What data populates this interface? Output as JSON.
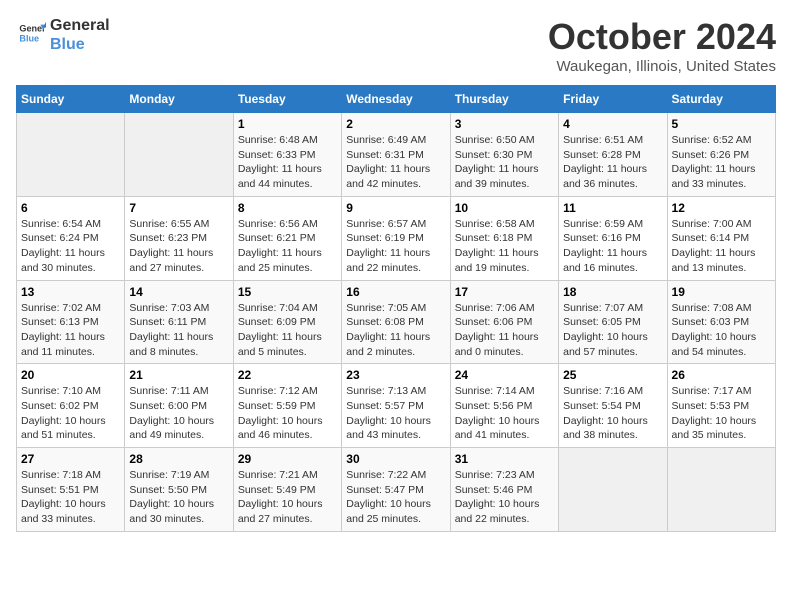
{
  "header": {
    "logo_line1": "General",
    "logo_line2": "Blue",
    "month": "October 2024",
    "location": "Waukegan, Illinois, United States"
  },
  "days_of_week": [
    "Sunday",
    "Monday",
    "Tuesday",
    "Wednesday",
    "Thursday",
    "Friday",
    "Saturday"
  ],
  "weeks": [
    [
      {
        "day": "",
        "empty": true
      },
      {
        "day": "",
        "empty": true
      },
      {
        "day": "1",
        "sunrise": "6:48 AM",
        "sunset": "6:33 PM",
        "daylight": "11 hours and 44 minutes."
      },
      {
        "day": "2",
        "sunrise": "6:49 AM",
        "sunset": "6:31 PM",
        "daylight": "11 hours and 42 minutes."
      },
      {
        "day": "3",
        "sunrise": "6:50 AM",
        "sunset": "6:30 PM",
        "daylight": "11 hours and 39 minutes."
      },
      {
        "day": "4",
        "sunrise": "6:51 AM",
        "sunset": "6:28 PM",
        "daylight": "11 hours and 36 minutes."
      },
      {
        "day": "5",
        "sunrise": "6:52 AM",
        "sunset": "6:26 PM",
        "daylight": "11 hours and 33 minutes."
      }
    ],
    [
      {
        "day": "6",
        "sunrise": "6:54 AM",
        "sunset": "6:24 PM",
        "daylight": "11 hours and 30 minutes."
      },
      {
        "day": "7",
        "sunrise": "6:55 AM",
        "sunset": "6:23 PM",
        "daylight": "11 hours and 27 minutes."
      },
      {
        "day": "8",
        "sunrise": "6:56 AM",
        "sunset": "6:21 PM",
        "daylight": "11 hours and 25 minutes."
      },
      {
        "day": "9",
        "sunrise": "6:57 AM",
        "sunset": "6:19 PM",
        "daylight": "11 hours and 22 minutes."
      },
      {
        "day": "10",
        "sunrise": "6:58 AM",
        "sunset": "6:18 PM",
        "daylight": "11 hours and 19 minutes."
      },
      {
        "day": "11",
        "sunrise": "6:59 AM",
        "sunset": "6:16 PM",
        "daylight": "11 hours and 16 minutes."
      },
      {
        "day": "12",
        "sunrise": "7:00 AM",
        "sunset": "6:14 PM",
        "daylight": "11 hours and 13 minutes."
      }
    ],
    [
      {
        "day": "13",
        "sunrise": "7:02 AM",
        "sunset": "6:13 PM",
        "daylight": "11 hours and 11 minutes."
      },
      {
        "day": "14",
        "sunrise": "7:03 AM",
        "sunset": "6:11 PM",
        "daylight": "11 hours and 8 minutes."
      },
      {
        "day": "15",
        "sunrise": "7:04 AM",
        "sunset": "6:09 PM",
        "daylight": "11 hours and 5 minutes."
      },
      {
        "day": "16",
        "sunrise": "7:05 AM",
        "sunset": "6:08 PM",
        "daylight": "11 hours and 2 minutes."
      },
      {
        "day": "17",
        "sunrise": "7:06 AM",
        "sunset": "6:06 PM",
        "daylight": "11 hours and 0 minutes."
      },
      {
        "day": "18",
        "sunrise": "7:07 AM",
        "sunset": "6:05 PM",
        "daylight": "10 hours and 57 minutes."
      },
      {
        "day": "19",
        "sunrise": "7:08 AM",
        "sunset": "6:03 PM",
        "daylight": "10 hours and 54 minutes."
      }
    ],
    [
      {
        "day": "20",
        "sunrise": "7:10 AM",
        "sunset": "6:02 PM",
        "daylight": "10 hours and 51 minutes."
      },
      {
        "day": "21",
        "sunrise": "7:11 AM",
        "sunset": "6:00 PM",
        "daylight": "10 hours and 49 minutes."
      },
      {
        "day": "22",
        "sunrise": "7:12 AM",
        "sunset": "5:59 PM",
        "daylight": "10 hours and 46 minutes."
      },
      {
        "day": "23",
        "sunrise": "7:13 AM",
        "sunset": "5:57 PM",
        "daylight": "10 hours and 43 minutes."
      },
      {
        "day": "24",
        "sunrise": "7:14 AM",
        "sunset": "5:56 PM",
        "daylight": "10 hours and 41 minutes."
      },
      {
        "day": "25",
        "sunrise": "7:16 AM",
        "sunset": "5:54 PM",
        "daylight": "10 hours and 38 minutes."
      },
      {
        "day": "26",
        "sunrise": "7:17 AM",
        "sunset": "5:53 PM",
        "daylight": "10 hours and 35 minutes."
      }
    ],
    [
      {
        "day": "27",
        "sunrise": "7:18 AM",
        "sunset": "5:51 PM",
        "daylight": "10 hours and 33 minutes."
      },
      {
        "day": "28",
        "sunrise": "7:19 AM",
        "sunset": "5:50 PM",
        "daylight": "10 hours and 30 minutes."
      },
      {
        "day": "29",
        "sunrise": "7:21 AM",
        "sunset": "5:49 PM",
        "daylight": "10 hours and 27 minutes."
      },
      {
        "day": "30",
        "sunrise": "7:22 AM",
        "sunset": "5:47 PM",
        "daylight": "10 hours and 25 minutes."
      },
      {
        "day": "31",
        "sunrise": "7:23 AM",
        "sunset": "5:46 PM",
        "daylight": "10 hours and 22 minutes."
      },
      {
        "day": "",
        "empty": true
      },
      {
        "day": "",
        "empty": true
      }
    ]
  ]
}
